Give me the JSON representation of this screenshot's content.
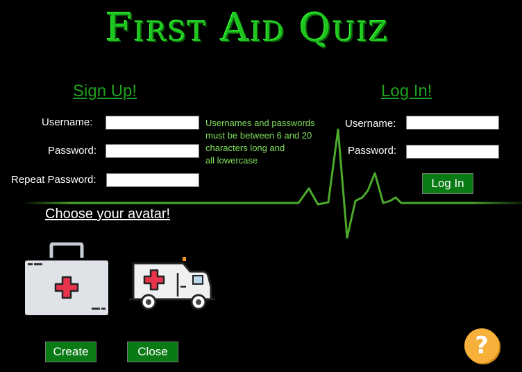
{
  "title": "First Aid Quiz",
  "signup": {
    "heading": "Sign Up!",
    "username_label": "Username:",
    "password_label": "Password:",
    "repeat_password_label": "Repeat Password:",
    "username_value": "",
    "password_value": "",
    "repeat_password_value": ""
  },
  "hint": {
    "line1": "Usernames and passwords",
    "line2": "must be between 6 and 20",
    "line3": "characters long and",
    "line4": "all lowercase"
  },
  "login": {
    "heading": "Log In!",
    "username_label": "Username:",
    "password_label": "Password:",
    "username_value": "",
    "password_value": "",
    "button_label": "Log In"
  },
  "avatar": {
    "heading": "Choose your avatar!",
    "options": [
      "first-aid-kit-icon",
      "ambulance-icon"
    ]
  },
  "buttons": {
    "create_label": "Create",
    "close_label": "Close"
  },
  "help": {
    "icon": "question-mark-icon",
    "glyph": "?"
  },
  "colors": {
    "title_green": "#1fc51f",
    "heading_green": "#1f9f1f",
    "hint_green": "#7fe05a",
    "button_green": "#0a7a14",
    "ecg_green": "#4caa2c",
    "help_orange": "#f7b13a"
  }
}
